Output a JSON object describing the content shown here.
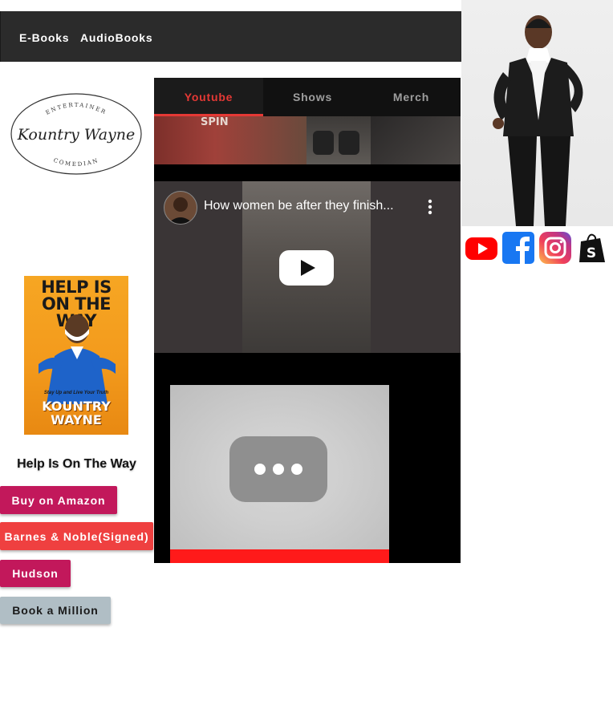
{
  "nav": {
    "links": [
      "E-Books",
      "AudioBooks"
    ]
  },
  "logo": {
    "top_text": "ENTERTAINER",
    "script_text": "Kountry Wayne",
    "bottom_text": "COMEDIAN"
  },
  "book": {
    "cover_title": "HELP IS ON THE WAY",
    "cover_subtitle": "Stay Up and Live Your Truth",
    "cover_author_line1": "KOUNTRY",
    "cover_author_line2": "WAYNE",
    "name": "Help Is On The Way"
  },
  "buy_buttons": [
    {
      "label": "Buy on Amazon",
      "color": "#c2185b"
    },
    {
      "label": "Barnes & Noble(Signed)",
      "color": "#ef4040"
    },
    {
      "label": "Hudson",
      "color": "#c2185b"
    },
    {
      "label": "Book a Million",
      "color": "#b0bec5"
    }
  ],
  "tabs": [
    {
      "label": "Youtube",
      "active": true
    },
    {
      "label": "Shows",
      "active": false
    },
    {
      "label": "Merch",
      "active": false
    }
  ],
  "thumb_strip": {
    "visible_text": "SPIN"
  },
  "video": {
    "title": "How women be after they finish..."
  },
  "social": [
    {
      "icon": "youtube-icon",
      "color": "#ff0000"
    },
    {
      "icon": "facebook-icon",
      "color": "#1877f2"
    },
    {
      "icon": "instagram-icon",
      "color": "#c13584"
    },
    {
      "icon": "shopify-icon",
      "color": "#111111"
    }
  ],
  "colors": {
    "accent": "#e53935",
    "nav_bg": "#2b2b2b",
    "tabs_bg": "#111111"
  }
}
